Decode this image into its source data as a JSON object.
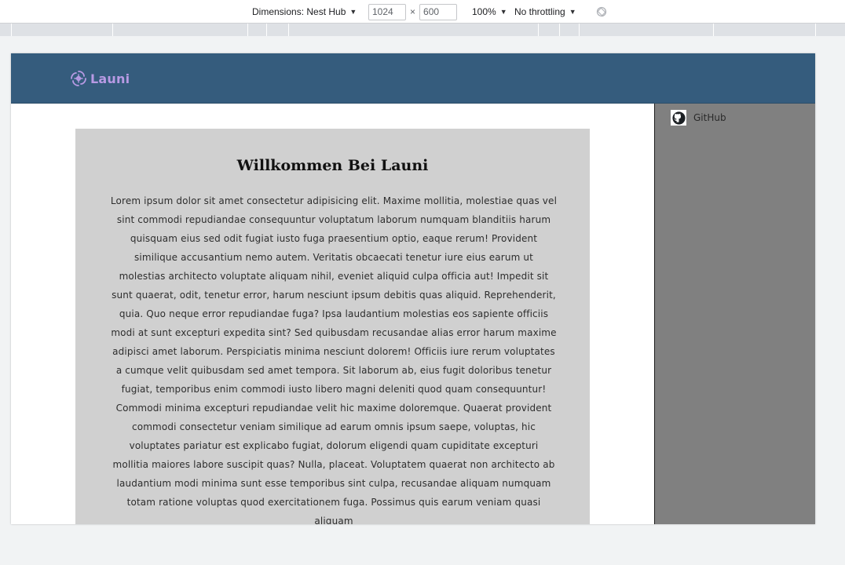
{
  "devtools": {
    "dimensions_label": "Dimensions: Nest Hub",
    "width_value": "1024",
    "times": "×",
    "height_value": "600",
    "zoom": "100%",
    "throttling": "No throttling"
  },
  "site": {
    "logo_text": "Launi",
    "sidebar": {
      "github_label": "GitHub"
    },
    "main": {
      "title": "Willkommen Bei Launi",
      "body": "Lorem ipsum dolor sit amet consectetur adipisicing elit. Maxime mollitia, molestiae quas vel sint commodi repudiandae consequuntur voluptatum laborum numquam blanditiis harum quisquam eius sed odit fugiat iusto fuga praesentium optio, eaque rerum! Provident similique accusantium nemo autem. Veritatis obcaecati tenetur iure eius earum ut molestias architecto voluptate aliquam nihil, eveniet aliquid culpa officia aut! Impedit sit sunt quaerat, odit, tenetur error, harum nesciunt ipsum debitis quas aliquid. Reprehenderit, quia. Quo neque error repudiandae fuga? Ipsa laudantium molestias eos sapiente officiis modi at sunt excepturi expedita sint? Sed quibusdam recusandae alias error harum maxime adipisci amet laborum. Perspiciatis minima nesciunt dolorem! Officiis iure rerum voluptates a cumque velit quibusdam sed amet tempora. Sit laborum ab, eius fugit doloribus tenetur fugiat, temporibus enim commodi iusto libero magni deleniti quod quam consequuntur! Commodi minima excepturi repudiandae velit hic maxime doloremque. Quaerat provident commodi consectetur veniam similique ad earum omnis ipsum saepe, voluptas, hic voluptates pariatur est explicabo fugiat, dolorum eligendi quam cupiditate excepturi mollitia maiores labore suscipit quas? Nulla, placeat. Voluptatem quaerat non architecto ab laudantium modi minima sunt esse temporibus sint culpa, recusandae aliquam numquam totam ratione voluptas quod exercitationem fuga. Possimus quis earum veniam quasi aliquam"
    }
  },
  "colors": {
    "header_bg": "#355c7d",
    "logo": "#b89ae4",
    "card_bg": "#d0d0d0",
    "sidebar_bg": "#808080"
  }
}
